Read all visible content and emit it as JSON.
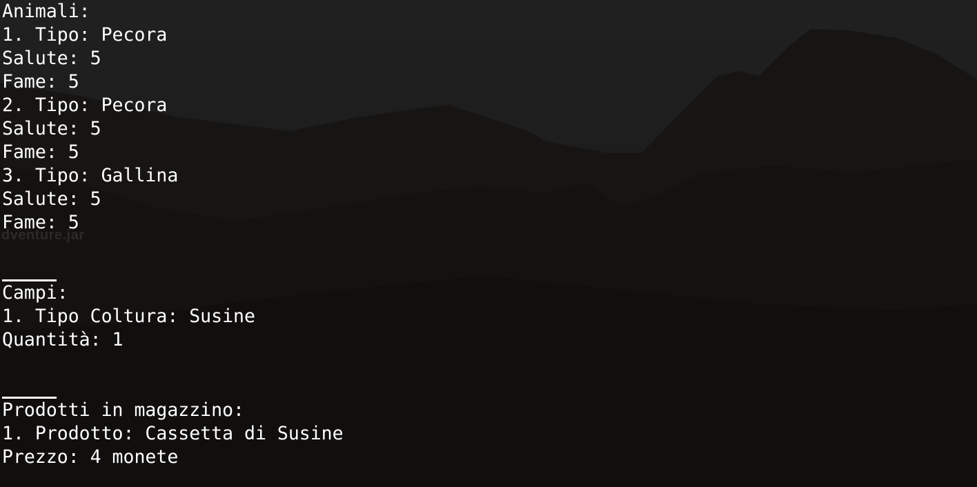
{
  "window": {
    "background_label": "dventure.jar"
  },
  "colors": {
    "text": "#ffffff",
    "background": "#1b1b1b"
  },
  "terminal": {
    "animals": {
      "header": "Animali:",
      "items": [
        {
          "tipo": "1. Tipo: Pecora",
          "salute": "Salute: 5",
          "fame": "Fame: 5"
        },
        {
          "tipo": "2. Tipo: Pecora",
          "salute": "Salute: 5",
          "fame": "Fame: 5"
        },
        {
          "tipo": "3. Tipo: Gallina",
          "salute": "Salute: 5",
          "fame": "Fame: 5"
        }
      ]
    },
    "fields": {
      "header": "Campi:",
      "items": [
        {
          "coltura": "1. Tipo Coltura: Susine",
          "quantita": "Quantità: 1"
        }
      ]
    },
    "warehouse": {
      "header": "Prodotti in magazzino:",
      "items": [
        {
          "prodotto": "1. Prodotto: Cassetta di Susine",
          "prezzo": "Prezzo: 4 monete"
        }
      ]
    }
  }
}
